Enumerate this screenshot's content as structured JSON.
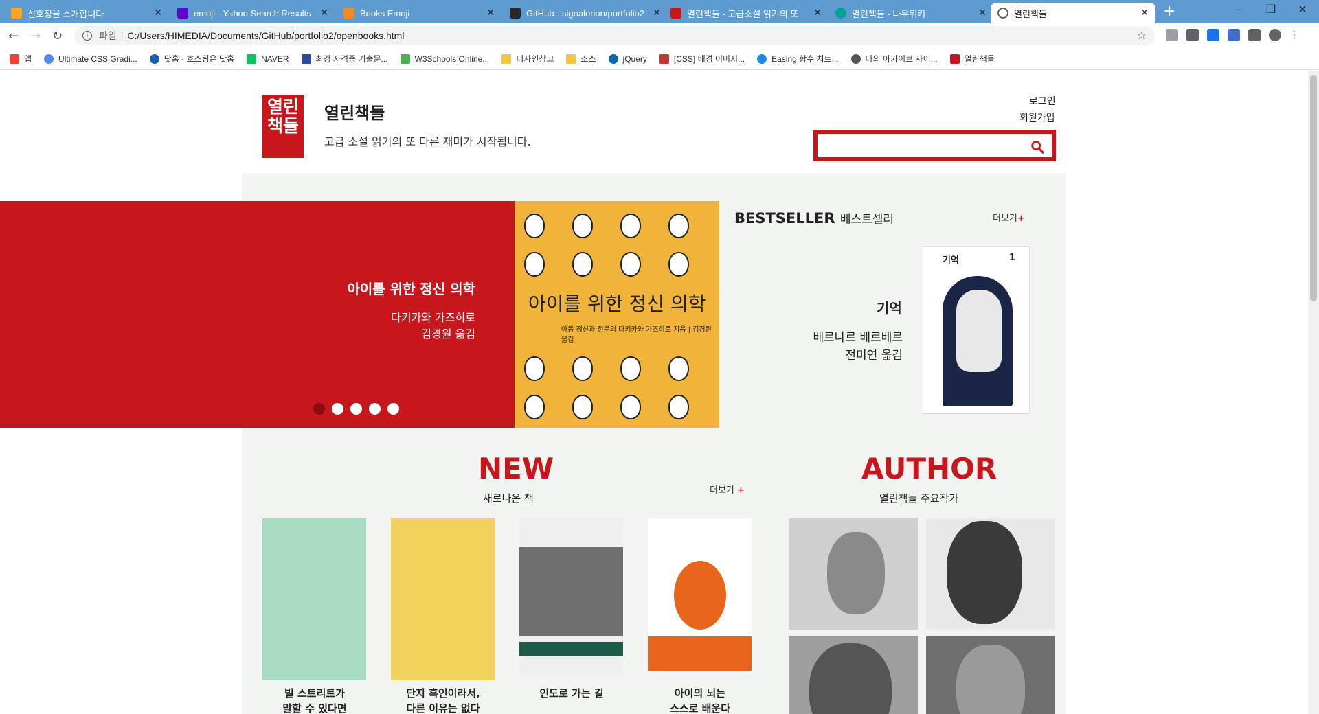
{
  "browser": {
    "tabs": [
      {
        "label": "신호정을 소개합니다",
        "color": "#f5a623"
      },
      {
        "label": "emoji - Yahoo Search Results",
        "color": "#6001d2"
      },
      {
        "label": "Books Emoji",
        "color": "#f08a24"
      },
      {
        "label": "GitHub - signalorion/portfolio2",
        "color": "#24292e"
      },
      {
        "label": "열린책들 - 고급소설 읽기의 또",
        "color": "#c8161d"
      },
      {
        "label": "열린책들 - 나무위키",
        "color": "#00a495"
      },
      {
        "label": "열린책들",
        "color": "#5f6368"
      }
    ],
    "new_tab": "+",
    "window_controls": [
      "–",
      "❐",
      "✕"
    ],
    "url_scheme": "파일",
    "url": "C:/Users/HIMEDIA/Documents/GitHub/portfolio2/openbooks.html",
    "bookmarks": [
      {
        "label": "앱",
        "color": "#ea4335"
      },
      {
        "label": "Ultimate CSS Gradi...",
        "color": "#4c8bf5"
      },
      {
        "label": "닷홈 - 호스팅은 닷홈",
        "color": "#1a5fb4"
      },
      {
        "label": "NAVER",
        "color": "#03c75a"
      },
      {
        "label": "최강 자격증 기출문...",
        "color": "#2b4c9b"
      },
      {
        "label": "W3Schools Online...",
        "color": "#4caf50"
      },
      {
        "label": "디자인참고",
        "color": "#f5c542"
      },
      {
        "label": "소스",
        "color": "#f5c542"
      },
      {
        "label": "jQuery",
        "color": "#0769ad"
      },
      {
        "label": "[CSS] 배경 이미지...",
        "color": "#c0392b"
      },
      {
        "label": "Easing 함수 치트...",
        "color": "#1e88e5"
      },
      {
        "label": "나의 아카이브 사이...",
        "color": "#555555"
      },
      {
        "label": "열린책들",
        "color": "#c8161d"
      }
    ]
  },
  "site": {
    "logo_text": "열린\n책들",
    "title": "열린책들",
    "tagline": "고급 소설 읽기의 또 다른 재미가 시작됩니다.",
    "login": "로그인",
    "signup": "회원가입",
    "search_placeholder": "",
    "accent": "#c8161d"
  },
  "hero": {
    "title": "아이를 위한 정신 의학",
    "author": "다키카와 가즈히로",
    "translator": "김경원 옮김",
    "cover_title": "아이를 위한 정신 의학",
    "cover_sub": "아동 정신과 전문의 다키카와 가즈히로 지음 | 김경원 옮김",
    "dots": 5,
    "active_dot": 0
  },
  "bestseller": {
    "title_en": "BESTSELLER",
    "title_ko": "베스트셀러",
    "more": "더보기",
    "book_title": "기억",
    "author": "베르나르 베르베르",
    "translator": "전미연 옮김",
    "cover_title": "기억",
    "cover_num": "1"
  },
  "new_section": {
    "title": "NEW",
    "subtitle": "새로나온 책",
    "more": "더보기",
    "books": [
      {
        "name": "빌 스트리트가\n말할 수 있다면",
        "color": "#a8dcc3"
      },
      {
        "name": "단지 흑인이라서,\n다른 이유는 없다",
        "color": "#f2d15c"
      },
      {
        "name": "인도로 가는 길",
        "color": "#efefef"
      },
      {
        "name": "아이의 뇌는\n스스로 배운다",
        "color": "#e8661c"
      }
    ]
  },
  "author_section": {
    "title": "AUTHOR",
    "subtitle": "열린책들 주요작가"
  }
}
